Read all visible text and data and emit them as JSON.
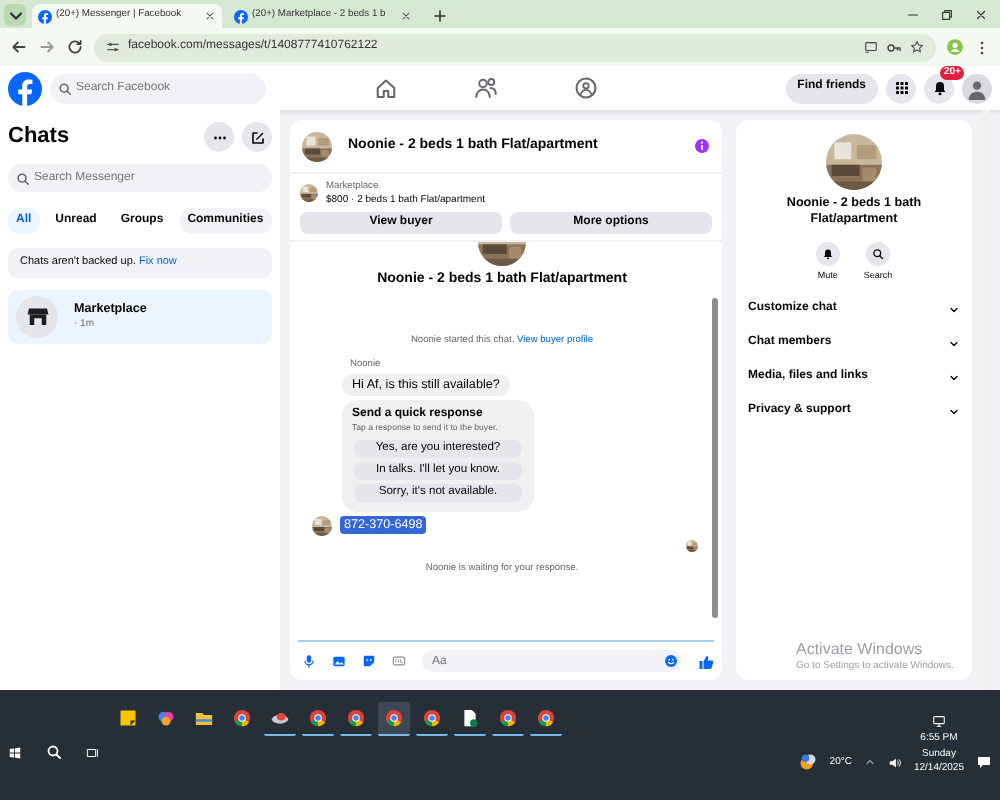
{
  "browser": {
    "tabs": [
      {
        "title": "(20+) Messenger | Facebook",
        "selected": true
      },
      {
        "title": "(20+) Marketplace - 2 beds 1 b",
        "selected": false
      }
    ],
    "url": "facebook.com/messages/t/1408777410762122"
  },
  "facebook_bar": {
    "search": {
      "placeholder": "Search Facebook"
    },
    "nav": [
      {
        "kind": "home"
      },
      {
        "kind": "friends"
      },
      {
        "kind": "groups"
      }
    ],
    "find_friends": "Find friends",
    "notifications_badge": "20+"
  },
  "sidebar": {
    "title": "Chats",
    "search": {
      "placeholder": "Search Messenger"
    },
    "filters": [
      {
        "label": "All",
        "selected": true
      },
      {
        "label": "Unread",
        "selected": false
      },
      {
        "label": "Groups",
        "selected": false
      },
      {
        "label": "Communities",
        "selected": false
      }
    ],
    "notice": {
      "text": "Chats aren't backed up.",
      "link": "Fix now"
    },
    "chats": [
      {
        "name": "Marketplace",
        "time": "· 1m",
        "selected": true
      }
    ]
  },
  "conversation": {
    "title": "Noonie - 2 beds 1 bath Flat/apartment",
    "listing": {
      "source": "Marketplace",
      "summary": "$800 · 2 beds 1 bath Flat/apartment",
      "buttons": [
        "View buyer",
        "More options"
      ]
    },
    "intro_title": "Noonie - 2 beds 1 bath Flat/apartment",
    "system_note": {
      "text": "Noonie started this chat.",
      "link": "View buyer profile"
    },
    "sender": "Noonie",
    "message": "Hi Af, is this still available?",
    "quick_response": {
      "title": "Send a quick response",
      "hint": "Tap a response to send it to the buyer.",
      "options": [
        "Yes, are you interested?",
        "In talks. I'll let you know.",
        "Sorry, it's not available."
      ]
    },
    "reply": {
      "text": "872-370-6498",
      "highlighted": true
    },
    "waiting_note": "Noonie is waiting for your response.",
    "composer": {
      "placeholder": "Aa"
    }
  },
  "details": {
    "title": "Noonie - 2 beds 1 bath Flat/apartment",
    "actions": [
      {
        "kind": "mute",
        "label": "Mute"
      },
      {
        "kind": "search",
        "label": "Search"
      }
    ],
    "sections": [
      {
        "label": "Customize chat",
        "expanded": false
      },
      {
        "label": "Chat members",
        "expanded": false
      },
      {
        "label": "Media, files and links",
        "expanded": false
      },
      {
        "label": "Privacy & support",
        "expanded": false
      }
    ]
  },
  "windows_notice": {
    "title": "Activate Windows",
    "text": "Go to Settings to activate Windows."
  },
  "taskbar": {
    "apps": [
      {
        "kind": "notes",
        "running": false,
        "selected": false
      },
      {
        "kind": "swirl",
        "running": false,
        "selected": false
      },
      {
        "kind": "folder",
        "running": false,
        "selected": false
      },
      {
        "kind": "browser",
        "running": false,
        "selected": false
      },
      {
        "kind": "cloud",
        "running": true,
        "selected": false
      },
      {
        "kind": "browser",
        "running": true,
        "selected": false
      },
      {
        "kind": "browser",
        "running": true,
        "selected": false
      },
      {
        "kind": "browser",
        "running": true,
        "selected": true
      },
      {
        "kind": "browser",
        "running": true,
        "selected": false
      },
      {
        "kind": "document",
        "running": true,
        "selected": false
      },
      {
        "kind": "browser",
        "running": true,
        "selected": false
      },
      {
        "kind": "browser",
        "running": true,
        "selected": false
      }
    ],
    "weather": "20°C",
    "time": "6:55 PM",
    "day": "Sunday",
    "date": "12/14/2025"
  }
}
